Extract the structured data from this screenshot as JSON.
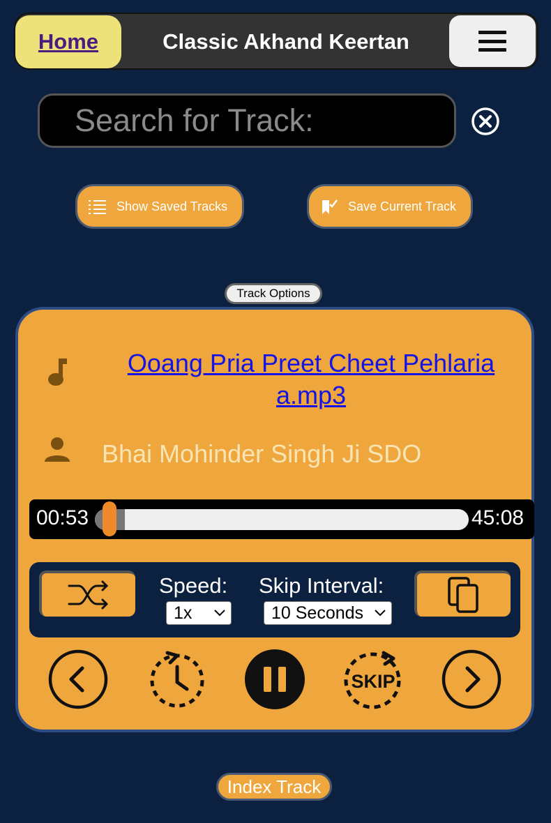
{
  "header": {
    "home_label": "Home",
    "title": "Classic Akhand Keertan",
    "menu_icon": "hamburger-menu-icon"
  },
  "search": {
    "placeholder": "Search for Track:",
    "value": "",
    "clear_icon": "close-circle-icon"
  },
  "actions": {
    "show_saved_label": "Show Saved Tracks",
    "show_saved_icon": "list-icon",
    "save_current_label": "Save Current Track",
    "save_current_icon": "bookmark-check-icon"
  },
  "track_options_label": "Track Options",
  "player": {
    "track_name": "Ooang Pria Preet Cheet Pehlaria a.mp3",
    "artist": "Bhai Mohinder Singh Ji SDO",
    "current_time": "00:53",
    "total_time": "45:08",
    "progress_fraction": 0.0196,
    "buffered_fraction": 0.08,
    "speed_label": "Speed:",
    "speed_value": "1x",
    "skip_interval_label": "Skip Interval:",
    "skip_interval_value": "10 Seconds"
  },
  "index_track_label": "Index Track",
  "colors": {
    "background": "#0c2140",
    "accent_orange": "#efa63c",
    "home_yellow": "#ede17a",
    "link_blue": "#1414e6",
    "thumb_orange": "#ef8a2a"
  }
}
